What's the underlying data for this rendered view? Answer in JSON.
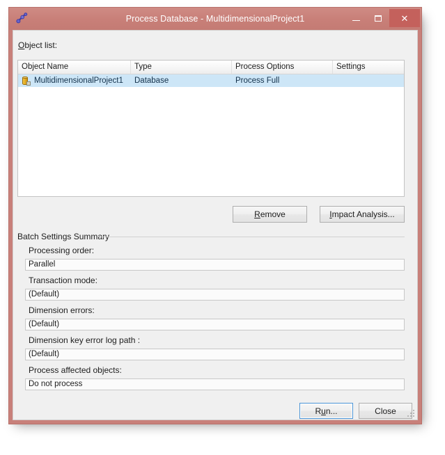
{
  "window": {
    "title": "Process Database - MultidimensionalProject1",
    "icon": "process-database-icon",
    "minimize_label": "–",
    "maximize_label": "❑",
    "close_label": "✕"
  },
  "object_list": {
    "label_prefix": "",
    "label_accel": "O",
    "label_rest": "bject list:",
    "columns": [
      "Object Name",
      "Type",
      "Process Options",
      "Settings"
    ],
    "rows": [
      {
        "icon": "database-icon",
        "object_name": "MultidimensionalProject1",
        "type": "Database",
        "process_options": "Process Full",
        "settings": ""
      }
    ]
  },
  "list_buttons": {
    "remove": {
      "pre": "",
      "accel": "R",
      "post": "emove"
    },
    "impact_analysis": {
      "pre": "",
      "accel": "I",
      "post": "mpact Analysis..."
    }
  },
  "batch_settings": {
    "group_title": "Batch Settings Summary",
    "items": [
      {
        "label": "Processing order:",
        "value": "Parallel"
      },
      {
        "label": "Transaction mode:",
        "value": "(Default)"
      },
      {
        "label": "Dimension errors:",
        "value": "(Default)"
      },
      {
        "label": "Dimension key error log path :",
        "value": "(Default)"
      },
      {
        "label": "Process affected objects:",
        "value": "Do not process"
      }
    ]
  },
  "dialog_buttons": {
    "run": {
      "pre": "R",
      "accel": "u",
      "post": "n..."
    },
    "close": {
      "pre": "Close",
      "accel": "",
      "post": ""
    }
  },
  "colors": {
    "window_frame": "#c8807a",
    "title_bar": "#c87f78",
    "close_button": "#c4615c",
    "client_bg": "#f0f0f0",
    "selection": "#cde6f7",
    "focus_border": "#4a94d6"
  }
}
